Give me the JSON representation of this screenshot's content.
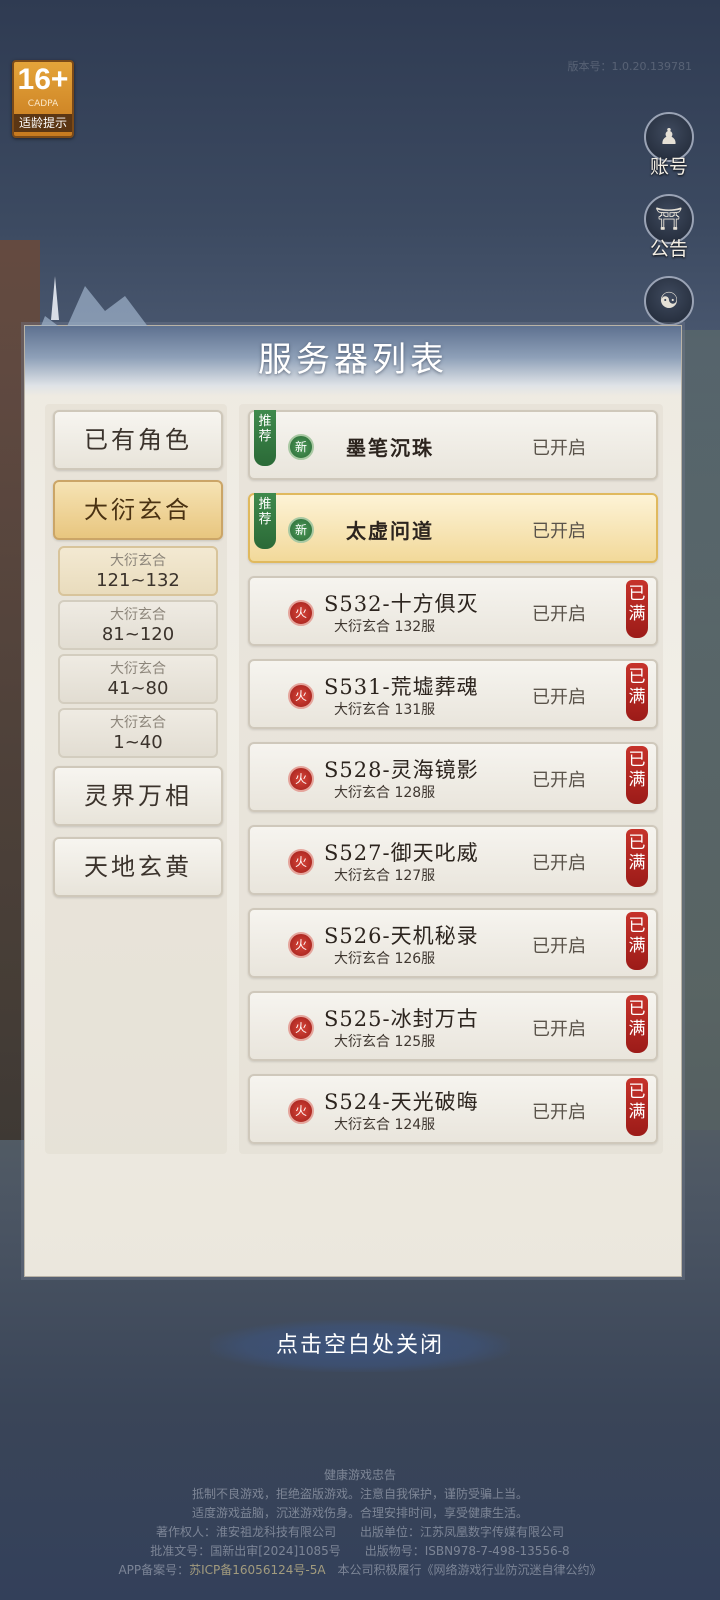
{
  "age_badge": {
    "rating": "16+",
    "org": "CADPA",
    "tip": "适龄提示"
  },
  "version": "版本号：1.0.20.139781",
  "side_buttons": [
    {
      "label": "账号",
      "icon": "account-icon"
    },
    {
      "label": "公告",
      "icon": "notice-icon"
    }
  ],
  "panel": {
    "title": "服务器列表",
    "categories": [
      "已有角色",
      "大衍玄合",
      "灵界万相",
      "天地玄黄"
    ],
    "sub_categories": [
      {
        "name": "大衍玄合",
        "range": "121~132"
      },
      {
        "name": "大衍玄合",
        "range": "81~120"
      },
      {
        "name": "大衍玄合",
        "range": "41~80"
      },
      {
        "name": "大衍玄合",
        "range": "1~40"
      }
    ],
    "rec_tag": "推荐",
    "new_icon": "新",
    "fire_icon": "火",
    "full_tag": "已满",
    "servers": [
      {
        "name": "墨笔沉珠",
        "status": "已开启"
      },
      {
        "name": "太虚问道",
        "status": "已开启"
      },
      {
        "name": "S532-十方俱灭",
        "sub": "大衍玄合 132服",
        "status": "已开启"
      },
      {
        "name": "S531-荒墟葬魂",
        "sub": "大衍玄合 131服",
        "status": "已开启"
      },
      {
        "name": "S528-灵海镜影",
        "sub": "大衍玄合 128服",
        "status": "已开启"
      },
      {
        "name": "S527-御天叱威",
        "sub": "大衍玄合 127服",
        "status": "已开启"
      },
      {
        "name": "S526-天机秘录",
        "sub": "大衍玄合 126服",
        "status": "已开启"
      },
      {
        "name": "S525-冰封万古",
        "sub": "大衍玄合 125服",
        "status": "已开启"
      },
      {
        "name": "S524-天光破晦",
        "sub": "大衍玄合 124服",
        "status": "已开启"
      }
    ]
  },
  "close_hint": "点击空白处关闭",
  "legal": {
    "title": "健康游戏忠告",
    "line1": "抵制不良游戏，拒绝盗版游戏。注意自我保护，谨防受骗上当。",
    "line2": "适度游戏益脑，沉迷游戏伤身。合理安排时间，享受健康生活。",
    "line3": "著作权人：淮安祖龙科技有限公司　　出版单位：江苏凤凰数字传媒有限公司",
    "line4": "批准文号：国新出审[2024]1085号　　出版物号：ISBN978-7-498-13556-8",
    "icp_label": "APP备案号：",
    "icp": "苏ICP备16056124号-5A",
    "line5_tail": "　本公司积极履行《网络游戏行业防沉迷自律公约》"
  },
  "colors": {
    "active_gold": "#e8c67f",
    "full_red": "#c6332b",
    "new_green": "#3f8a4d"
  }
}
